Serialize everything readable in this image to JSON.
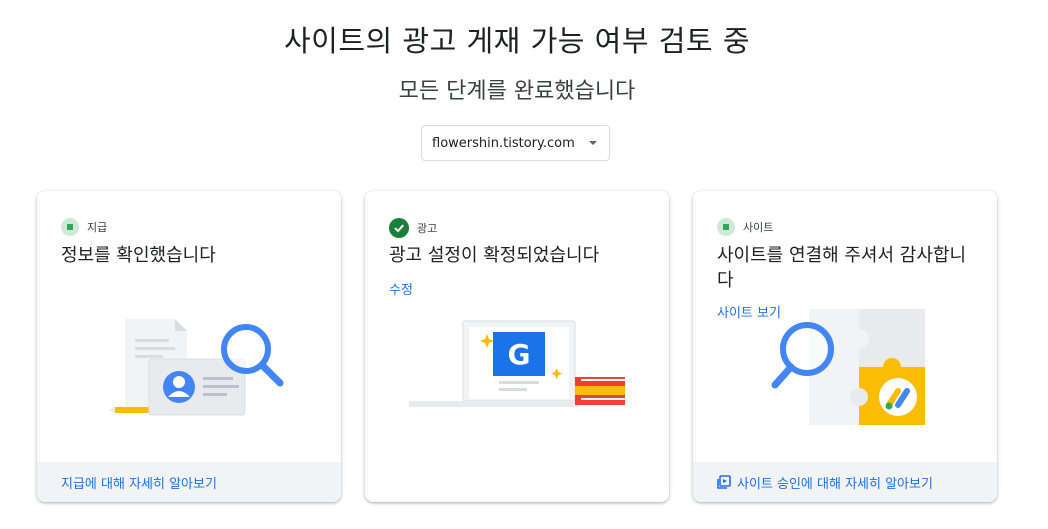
{
  "header": {
    "title": "사이트의 광고 게재 가능 여부 검토 중",
    "subtitle": "모든 단계를 완료했습니다"
  },
  "site_selector": {
    "value": "flowershin.tistory.com",
    "icon": "dropdown-caret-icon"
  },
  "cards": [
    {
      "step_label": "지급",
      "status": "pending",
      "title": "정보를 확인했습니다",
      "link": "",
      "footer_link": "지급에 대해 자세히 알아보기",
      "illustration": "payment-id-search-illustration"
    },
    {
      "step_label": "광고",
      "status": "complete",
      "title": "광고 설정이 확정되었습니다",
      "link": "수정",
      "footer_link": "",
      "illustration": "laptop-google-ads-illustration"
    },
    {
      "step_label": "사이트",
      "status": "pending",
      "title": "사이트를 연결해 주셔서 감사합니다",
      "link": "사이트 보기",
      "footer_link": "사이트 승인에 대해 자세히 알아보기",
      "illustration": "puzzle-adsense-illustration"
    }
  ],
  "colors": {
    "accent_blue": "#1a73e8",
    "success_green": "#188038",
    "pending_bg": "#ceead6",
    "ads_yellow": "#fbbc04",
    "footer_bg": "#f1f3f4"
  }
}
